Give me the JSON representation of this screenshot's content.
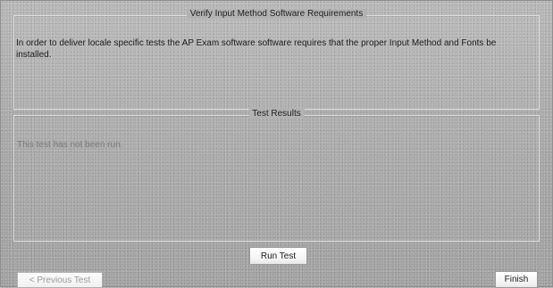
{
  "requirements": {
    "title": "Verify Input Method Software Requirements",
    "text": "In order to deliver locale specific tests the AP Exam software software requires that the proper Input Method and Fonts be installed."
  },
  "results": {
    "title": "Test Results",
    "status": "This test has not been run."
  },
  "buttons": {
    "run_test": "Run Test",
    "previous_test": "< Previous Test",
    "finish": "Finish"
  }
}
